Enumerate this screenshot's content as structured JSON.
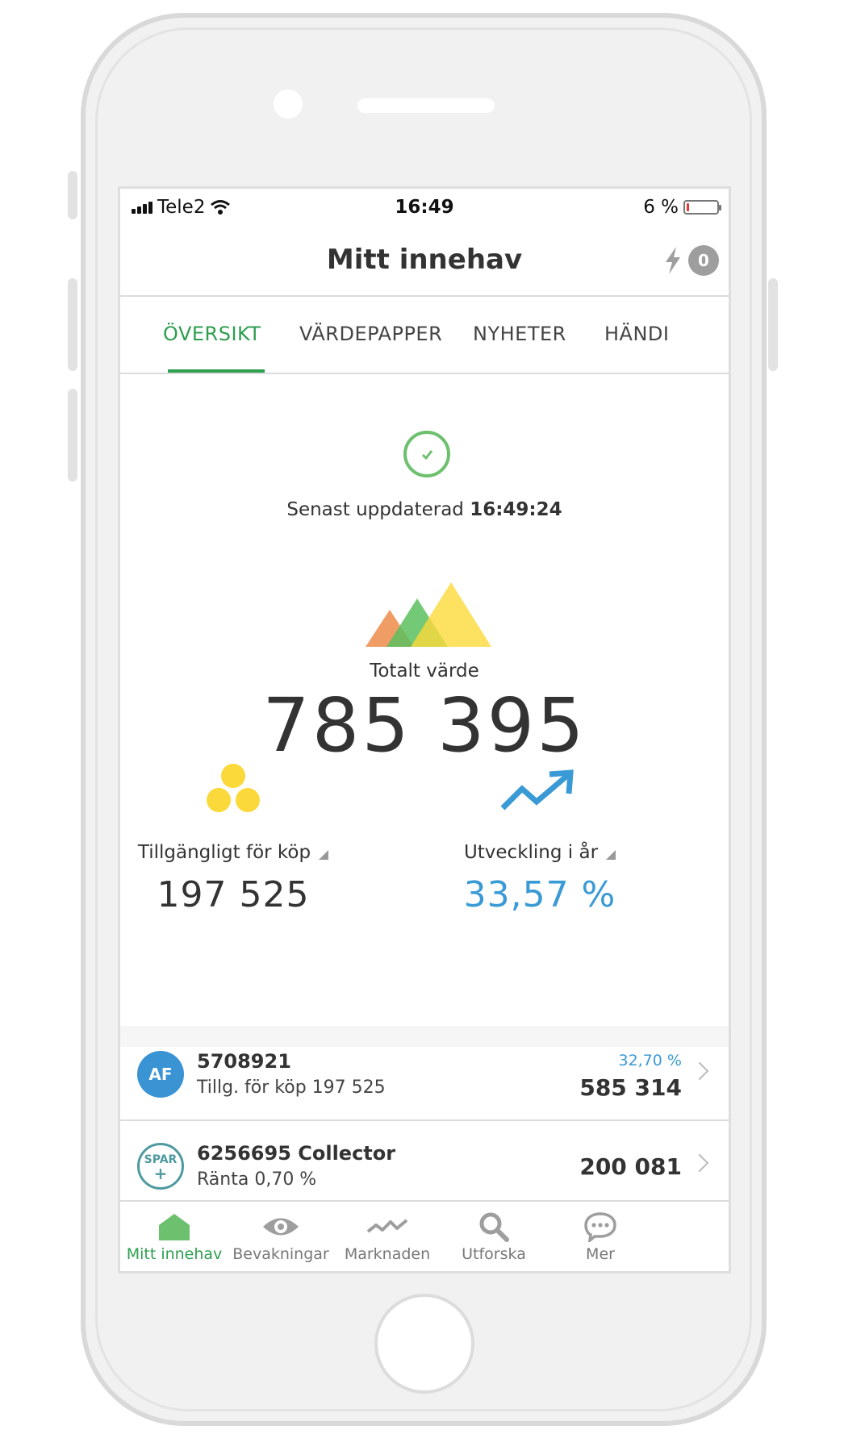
{
  "statusbar": {
    "carrier": "Tele2",
    "time": "16:49",
    "battery_percent": "6 %",
    "battery_level": 0.06,
    "battery_color": "#e53935"
  },
  "nav": {
    "title": "Mitt innehav",
    "notification_count": "0"
  },
  "tabs": [
    {
      "label": "ÖVERSIKT",
      "active": true
    },
    {
      "label": "VÄRDEPAPPER",
      "active": false
    },
    {
      "label": "NYHETER",
      "active": false
    },
    {
      "label": "HÄNDI",
      "active": false
    }
  ],
  "overview": {
    "updated_prefix": "Senast uppdaterad",
    "updated_time": "16:49:24",
    "total_label": "Totalt värde",
    "total_value": "785 395",
    "available_label": "Tillgängligt för köp",
    "available_value": "197 525",
    "development_label": "Utveckling i år",
    "development_value": "33,57 %"
  },
  "accounts": [
    {
      "icon_text": "AF",
      "name": "5708921",
      "sub": "Tillg. för köp 197 525",
      "percent": "32,70 %",
      "value": "585 314"
    },
    {
      "icon_text_top": "SPAR",
      "icon_text_bottom": "+",
      "name": "6256695 Collector",
      "sub": "Ränta 0,70 %",
      "value": "200 081"
    }
  ],
  "tabbar": [
    {
      "label": "Mitt innehav",
      "icon": "home-icon",
      "active": true
    },
    {
      "label": "Bevakningar",
      "icon": "eye-icon",
      "active": false
    },
    {
      "label": "Marknaden",
      "icon": "chart-line-icon",
      "active": false
    },
    {
      "label": "Utforska",
      "icon": "search-icon",
      "active": false
    },
    {
      "label": "Mer",
      "icon": "chat-bubble-icon",
      "active": false
    }
  ],
  "colors": {
    "accent_green": "#2e9e4f",
    "accent_blue": "#3a9ad6",
    "yellow": "#fcd93a",
    "orange": "#ec8c4a",
    "green": "#5bbf5e"
  }
}
